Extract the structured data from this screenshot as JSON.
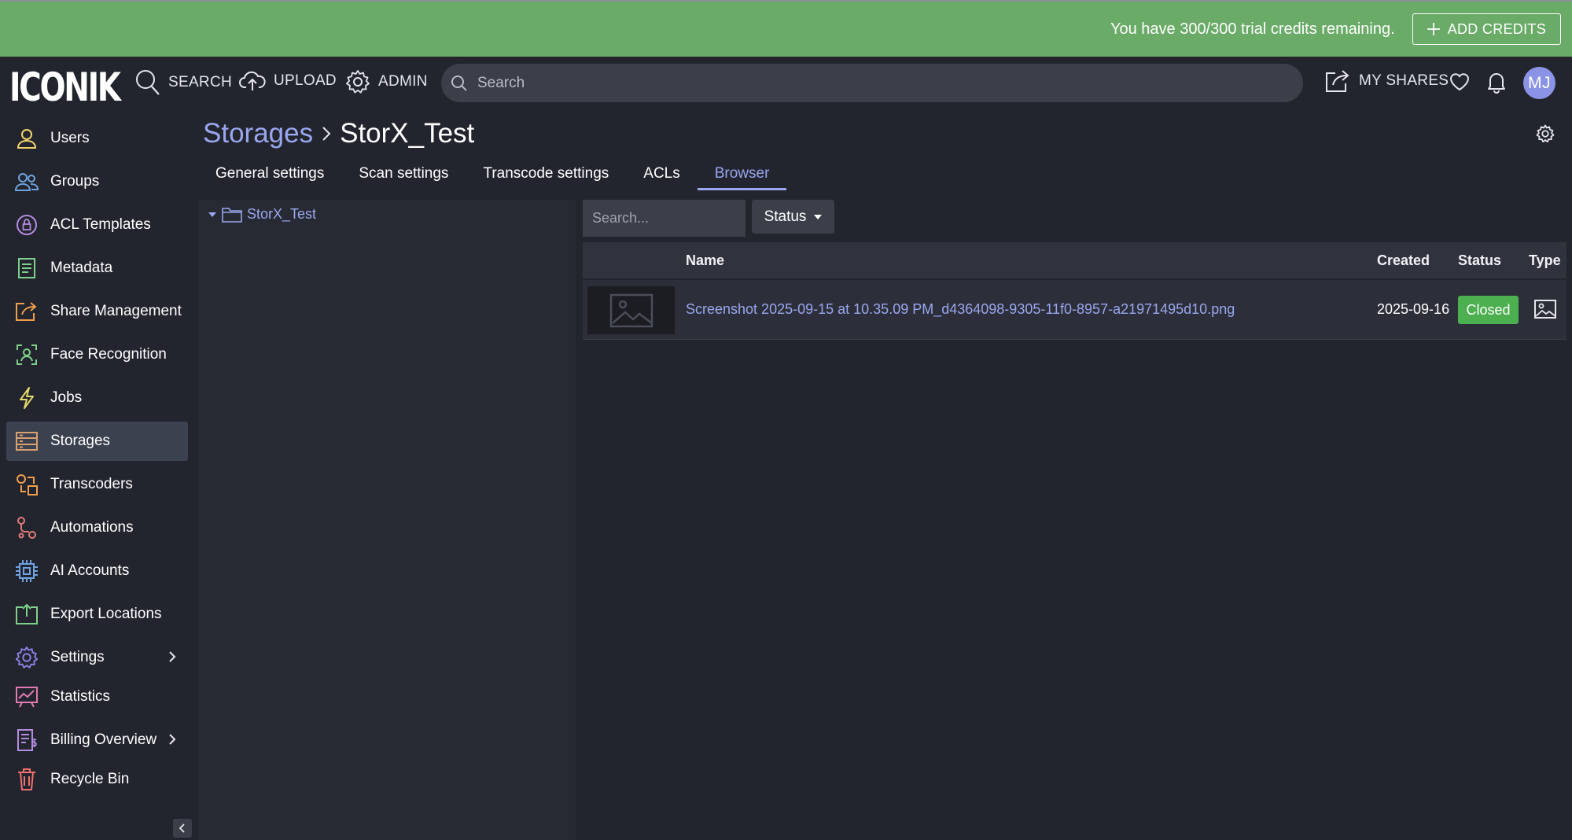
{
  "banner": {
    "message": "You have 300/300 trial credits remaining.",
    "add_credits_label": "ADD CREDITS"
  },
  "topnav": {
    "logo": "ICONIK",
    "search_label": "SEARCH",
    "upload_label": "UPLOAD",
    "admin_label": "ADMIN",
    "search_placeholder": "Search",
    "my_shares_label": "MY SHARES",
    "avatar_initials": "MJ"
  },
  "sidebar": {
    "items": [
      {
        "label": "Users",
        "icon": "user-icon",
        "color": "#f2d36b"
      },
      {
        "label": "Groups",
        "icon": "users-icon",
        "color": "#6fa3e0"
      },
      {
        "label": "ACL Templates",
        "icon": "lock-circle-icon",
        "color": "#b58be0"
      },
      {
        "label": "Metadata",
        "icon": "document-icon",
        "color": "#7fd08a"
      },
      {
        "label": "Share Management",
        "icon": "share-icon",
        "color": "#f0a04b"
      },
      {
        "label": "Face Recognition",
        "icon": "face-scan-icon",
        "color": "#7fd08a"
      },
      {
        "label": "Jobs",
        "icon": "bolt-icon",
        "color": "#e7d96a"
      },
      {
        "label": "Storages",
        "icon": "storage-icon",
        "color": "#d8a070"
      },
      {
        "label": "Transcoders",
        "icon": "transcoder-icon",
        "color": "#f0a04b"
      },
      {
        "label": "Automations",
        "icon": "automation-icon",
        "color": "#e07a7a"
      },
      {
        "label": "AI Accounts",
        "icon": "chip-icon",
        "color": "#6fa3e0"
      },
      {
        "label": "Export Locations",
        "icon": "export-icon",
        "color": "#7fd08a"
      },
      {
        "label": "Settings",
        "icon": "gear-icon",
        "color": "#8b84e8"
      },
      {
        "label": "Statistics",
        "icon": "chart-icon",
        "color": "#e07ab0"
      },
      {
        "label": "Billing Overview",
        "icon": "billing-icon",
        "color": "#b58be0"
      },
      {
        "label": "Recycle Bin",
        "icon": "trash-icon",
        "color": "#f07070"
      }
    ],
    "active_index": 7
  },
  "breadcrumb": {
    "parent": "Storages",
    "current": "StorX_Test"
  },
  "tabs": [
    {
      "label": "General settings"
    },
    {
      "label": "Scan settings"
    },
    {
      "label": "Transcode settings"
    },
    {
      "label": "ACLs"
    },
    {
      "label": "Browser"
    }
  ],
  "active_tab": 4,
  "tree": {
    "root": "StorX_Test"
  },
  "browser": {
    "search_placeholder": "Search...",
    "status_filter_label": "Status",
    "columns": {
      "name": "Name",
      "created": "Created",
      "status": "Status",
      "type": "Type"
    },
    "rows": [
      {
        "name": "Screenshot 2025-09-15 at 10.35.09 PM_d4364098-9305-11f0-8957-a21971495d10.png",
        "created": "2025-09-16",
        "status": "Closed",
        "type_icon": "image-icon"
      }
    ]
  },
  "colors": {
    "banner_green": "#6aab68",
    "accent": "#9aa6ee",
    "status_closed": "#4caf50",
    "background": "#22252e"
  }
}
